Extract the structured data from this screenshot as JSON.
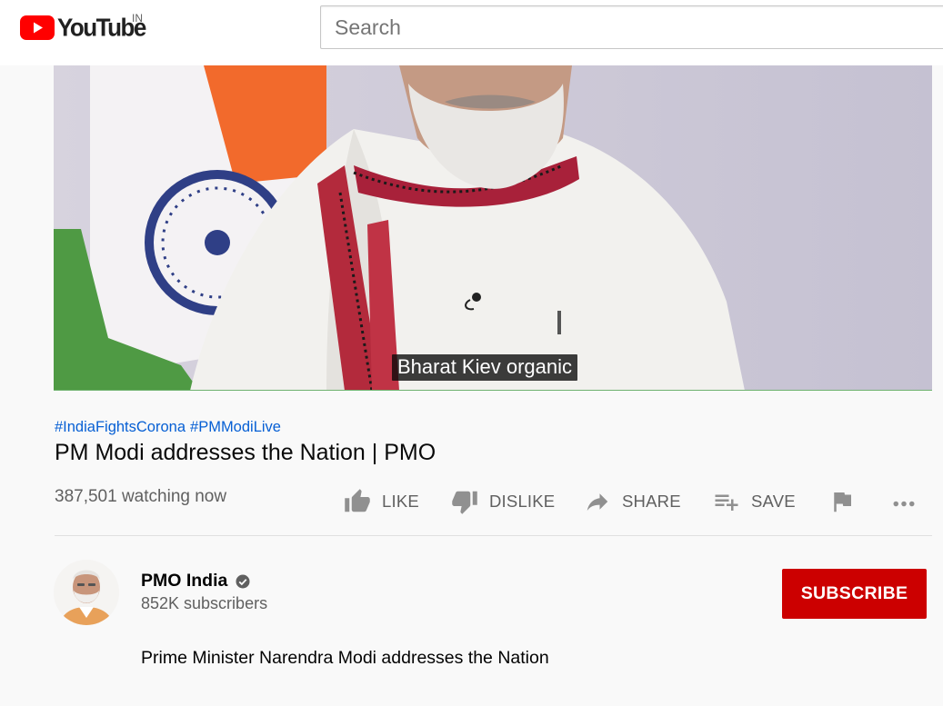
{
  "header": {
    "logo_text": "YouTube",
    "country_code": "IN",
    "search_placeholder": "Search"
  },
  "player": {
    "caption": "Bharat Kiev organic"
  },
  "video": {
    "hashtags": [
      "#IndiaFightsCorona",
      "#PMModiLive"
    ],
    "title": "PM Modi addresses the Nation | PMO",
    "watching": "387,501 watching now"
  },
  "actions": {
    "like": "LIKE",
    "dislike": "DISLIKE",
    "share": "SHARE",
    "save": "SAVE"
  },
  "channel": {
    "name": "PMO India",
    "subscribers": "852K subscribers",
    "subscribe_label": "SUBSCRIBE"
  },
  "description": "Prime Minister Narendra Modi addresses the Nation",
  "colors": {
    "brand_red": "#ff0000",
    "subscribe_red": "#cc0000",
    "link_blue": "#065fd4"
  }
}
